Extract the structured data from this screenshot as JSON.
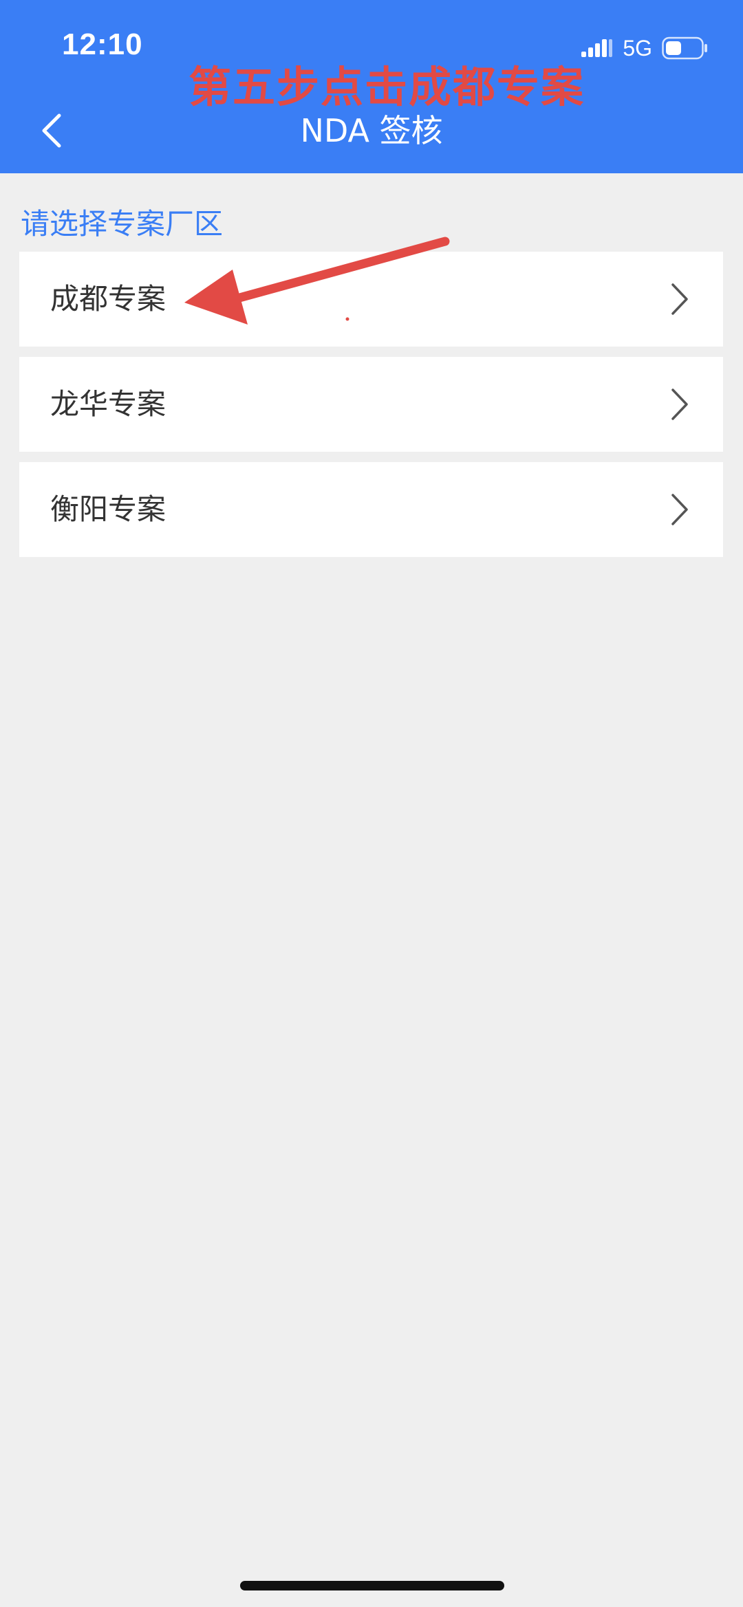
{
  "status_bar": {
    "time": "12:10",
    "network": "5G",
    "icons": [
      "signal-icon",
      "battery-icon"
    ]
  },
  "annotation": {
    "title": "第五步点击成都专案",
    "color": "#e24a45"
  },
  "nav": {
    "title": "NDA 签核",
    "back_icon": "chevron-left-icon"
  },
  "section": {
    "label": "请选择专案厂区"
  },
  "items": [
    {
      "label": "成都专案"
    },
    {
      "label": "龙华专案"
    },
    {
      "label": "衡阳专案"
    }
  ],
  "colors": {
    "header": "#3a7ef5",
    "background": "#efefef",
    "accent": "#3a7ef5"
  }
}
